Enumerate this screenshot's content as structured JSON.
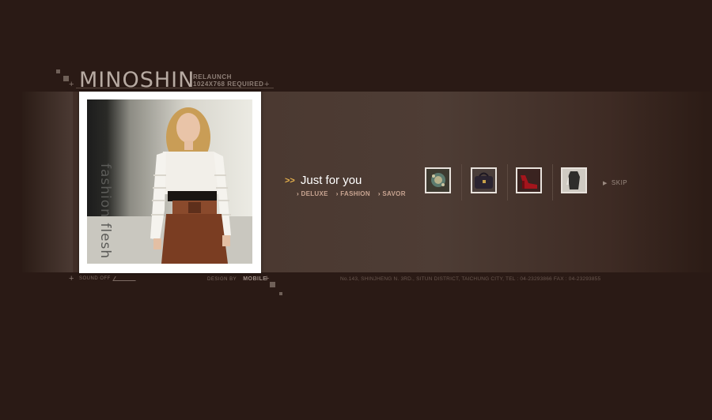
{
  "brand": {
    "name": "MINOSHIN",
    "relaunch_line1": "RELAUNCH",
    "relaunch_line2": "1024X768  REQUIRED"
  },
  "feature": {
    "vertical_caption": "fashion flesh"
  },
  "promo": {
    "arrows": ">>",
    "title": "Just for you",
    "links": [
      "DELUXE",
      "FASHION",
      "SAVOR"
    ]
  },
  "thumbnails": [
    {
      "icon": "brooch-thumbnail"
    },
    {
      "icon": "handbag-thumbnail"
    },
    {
      "icon": "red-shoe-thumbnail"
    },
    {
      "icon": "dark-dress-thumbnail"
    }
  ],
  "skip_label": "SKIP",
  "footer": {
    "sound_label": "SOUND OFF",
    "design_label": "DESIGN BY",
    "design_studio": "MOBILE",
    "address": "No.143, SHINJHENG N. 3RD., SITUN DISTRICT, TAICHUNG CITY,  TEL : 04-23293866    FAX : 04-23293855"
  },
  "colors": {
    "background": "#2a1a15",
    "band": "#4a3830",
    "accent": "#e7b24d",
    "link": "#c8a491"
  }
}
